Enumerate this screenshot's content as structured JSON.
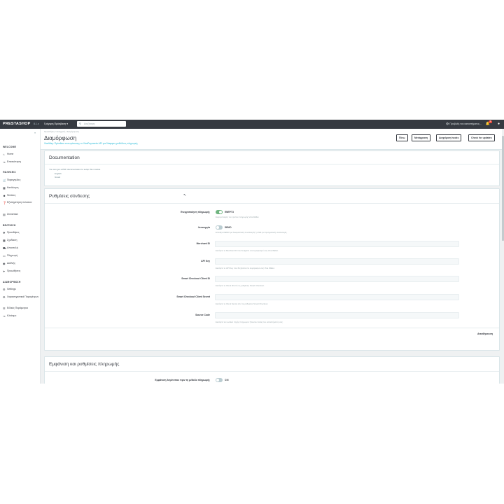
{
  "topbar": {
    "logo": "PRESTASHOP",
    "version": "8.1.x",
    "quick_access": "Γρήγορη Πρόσβαση ▾",
    "search_placeholder": "Αναζήτηση",
    "shop_link": "Προβολή του καταστήματος...",
    "notifications_count": "3"
  },
  "sidebar": {
    "sections": [
      {
        "title": "WELCOME",
        "items": [
          {
            "label": "Home",
            "icon": "home-icon"
          },
          {
            "label": "Επισκόπηση",
            "icon": "trend-icon"
          }
        ]
      },
      {
        "title": "ΠΩΛΗΣΕΙΣ",
        "items": [
          {
            "label": "Παραγγελίες",
            "icon": "cart-icon"
          },
          {
            "label": "Κατάλογος",
            "icon": "catalog-icon"
          },
          {
            "label": "Πελάτες",
            "icon": "person-icon"
          },
          {
            "label": "Εξυπηρέτηση πελατών",
            "icon": "help-icon"
          },
          {
            "label": "Στατιστικά",
            "icon": "stats-icon"
          }
        ]
      },
      {
        "title": "ΒΕΛΤΙΩΣΗ",
        "items": [
          {
            "label": "Προσθήκες",
            "icon": "puzzle-icon"
          },
          {
            "label": "Σχεδίαση",
            "icon": "desktop-icon"
          },
          {
            "label": "Αποστολή",
            "icon": "truck-icon"
          },
          {
            "label": "Πληρωμή",
            "icon": "card-icon"
          },
          {
            "label": "Διεθνής",
            "icon": "globe-icon"
          },
          {
            "label": "Προωθήσεις",
            "icon": "promo-icon"
          }
        ]
      },
      {
        "title": "ΔΙΑΜΟΡΦΩΣΗ",
        "items": [
          {
            "label": "Settings",
            "icon": "gear-icon"
          },
          {
            "label": "Χαρακτηριστικά Παραμέτρων",
            "icon": "gear2-icon"
          },
          {
            "label": "Ειδικές Παράμετροι",
            "icon": "list-icon"
          },
          {
            "label": "Κλείσιμο",
            "icon": "trend2-icon"
          }
        ]
      }
    ]
  },
  "header": {
    "breadcrumb": "Προσθήκες  /  Ακαγχολή  /  Διαμόρφωση",
    "title": "Διαμόρφωση",
    "subtitle": "VivaWay: Πρόσθετο ενσωμάτωσης το VivaPayments API για διάφορες μεθόδους πληρωμής",
    "buttons": {
      "back": "Πίσω",
      "translate": "Μετάφραση",
      "manage_hooks": "Διαχείριση hooks",
      "check_updates": "Check for updates"
    }
  },
  "documentation": {
    "title": "Documentation",
    "intro": "You can get a PDF documentation to setup this module",
    "languages": [
      "English",
      "Greek"
    ]
  },
  "connection": {
    "title": "Ρυθμίσεις σύνδεσης",
    "enable_label": "Ενεργοποίηση πληρωμής",
    "enable_value": "ΕΝΕΡΓΟ",
    "enable_help": "Ενεργοποίηση του τρόπου πληρωμής Viva Wallet.",
    "mode_label": "Λειτουργία",
    "mode_value": "DEMO",
    "mode_help": "Επιλέξτε DEMO για δοκιμαστικές συναλλαγές ή LIVE για πραγματικές συναλλαγές.",
    "merchant_label": "Merchant ID",
    "merchant_help": "Εισάγετε το Merchant ID που θα βρείτε στο λογαριασμό σας Viva Wallet.",
    "api_label": "API Key",
    "api_help": "Εισάγετε το API Key που θα βρείτε στο λογαριασμό σας Viva Wallet.",
    "client_id_label": "Smart Checkout Client ID",
    "client_id_help": "Εισάγετε το Client ID από τις ρυθμίσεις Smart Checkout.",
    "client_secret_label": "Smart Checkout Client Secret",
    "client_secret_help": "Εισάγετε το Client Secret από τις ρυθμίσεις Smart Checkout.",
    "source_label": "Source Code",
    "source_help": "Εισάγετε τον κωδικό πηγής πληρωμών (Source Code) του καταστήματός σας.",
    "save": "Αποθήκευση"
  },
  "appearance": {
    "title": "Εμφάνιση και ρυθμίσεις πληρωμής",
    "option_label": "Εμφάνιση λογότυπου πριν τη μέθοδο πληρωμής",
    "option_value": "ΟΧΙ"
  },
  "colors": {
    "topbar": "#363a41",
    "accent": "#25b9d7",
    "toggle_on": "#70b580",
    "toggle_off": "#bbcdd2"
  }
}
